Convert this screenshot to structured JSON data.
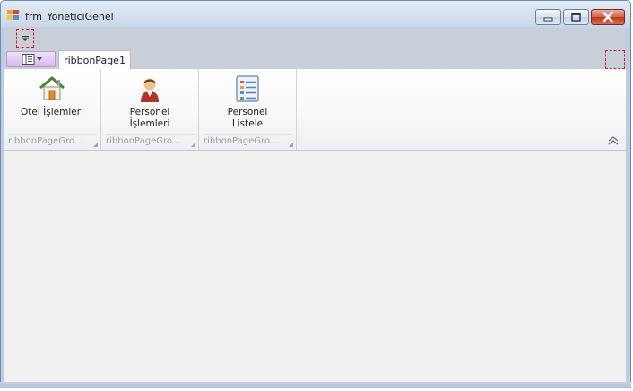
{
  "window": {
    "title": "frm_YoneticiGenel",
    "min_icon": "minimize-icon",
    "max_icon": "maximize-icon",
    "close_icon": "close-icon"
  },
  "ribbon": {
    "tabs": [
      {
        "label": "ribbonPage1",
        "selected": true
      }
    ],
    "groups": [
      {
        "caption": "ribbonPageGro...",
        "button_line1": "Otel İşlemleri",
        "button_line2": "",
        "icon": "house-icon"
      },
      {
        "caption": "ribbonPageGro...",
        "button_line1": "Personel",
        "button_line2": "İşlemleri",
        "icon": "person-icon"
      },
      {
        "caption": "ribbonPageGro...",
        "button_line1": "Personel",
        "button_line2": "Listele",
        "icon": "list-icon"
      }
    ]
  },
  "colors": {
    "titlebar": "#c9d8ea",
    "ribbon_bg": "#ffffff",
    "client_bg": "#f0f0f0",
    "close_red": "#c0391f",
    "selection_dash": "#e01818"
  }
}
